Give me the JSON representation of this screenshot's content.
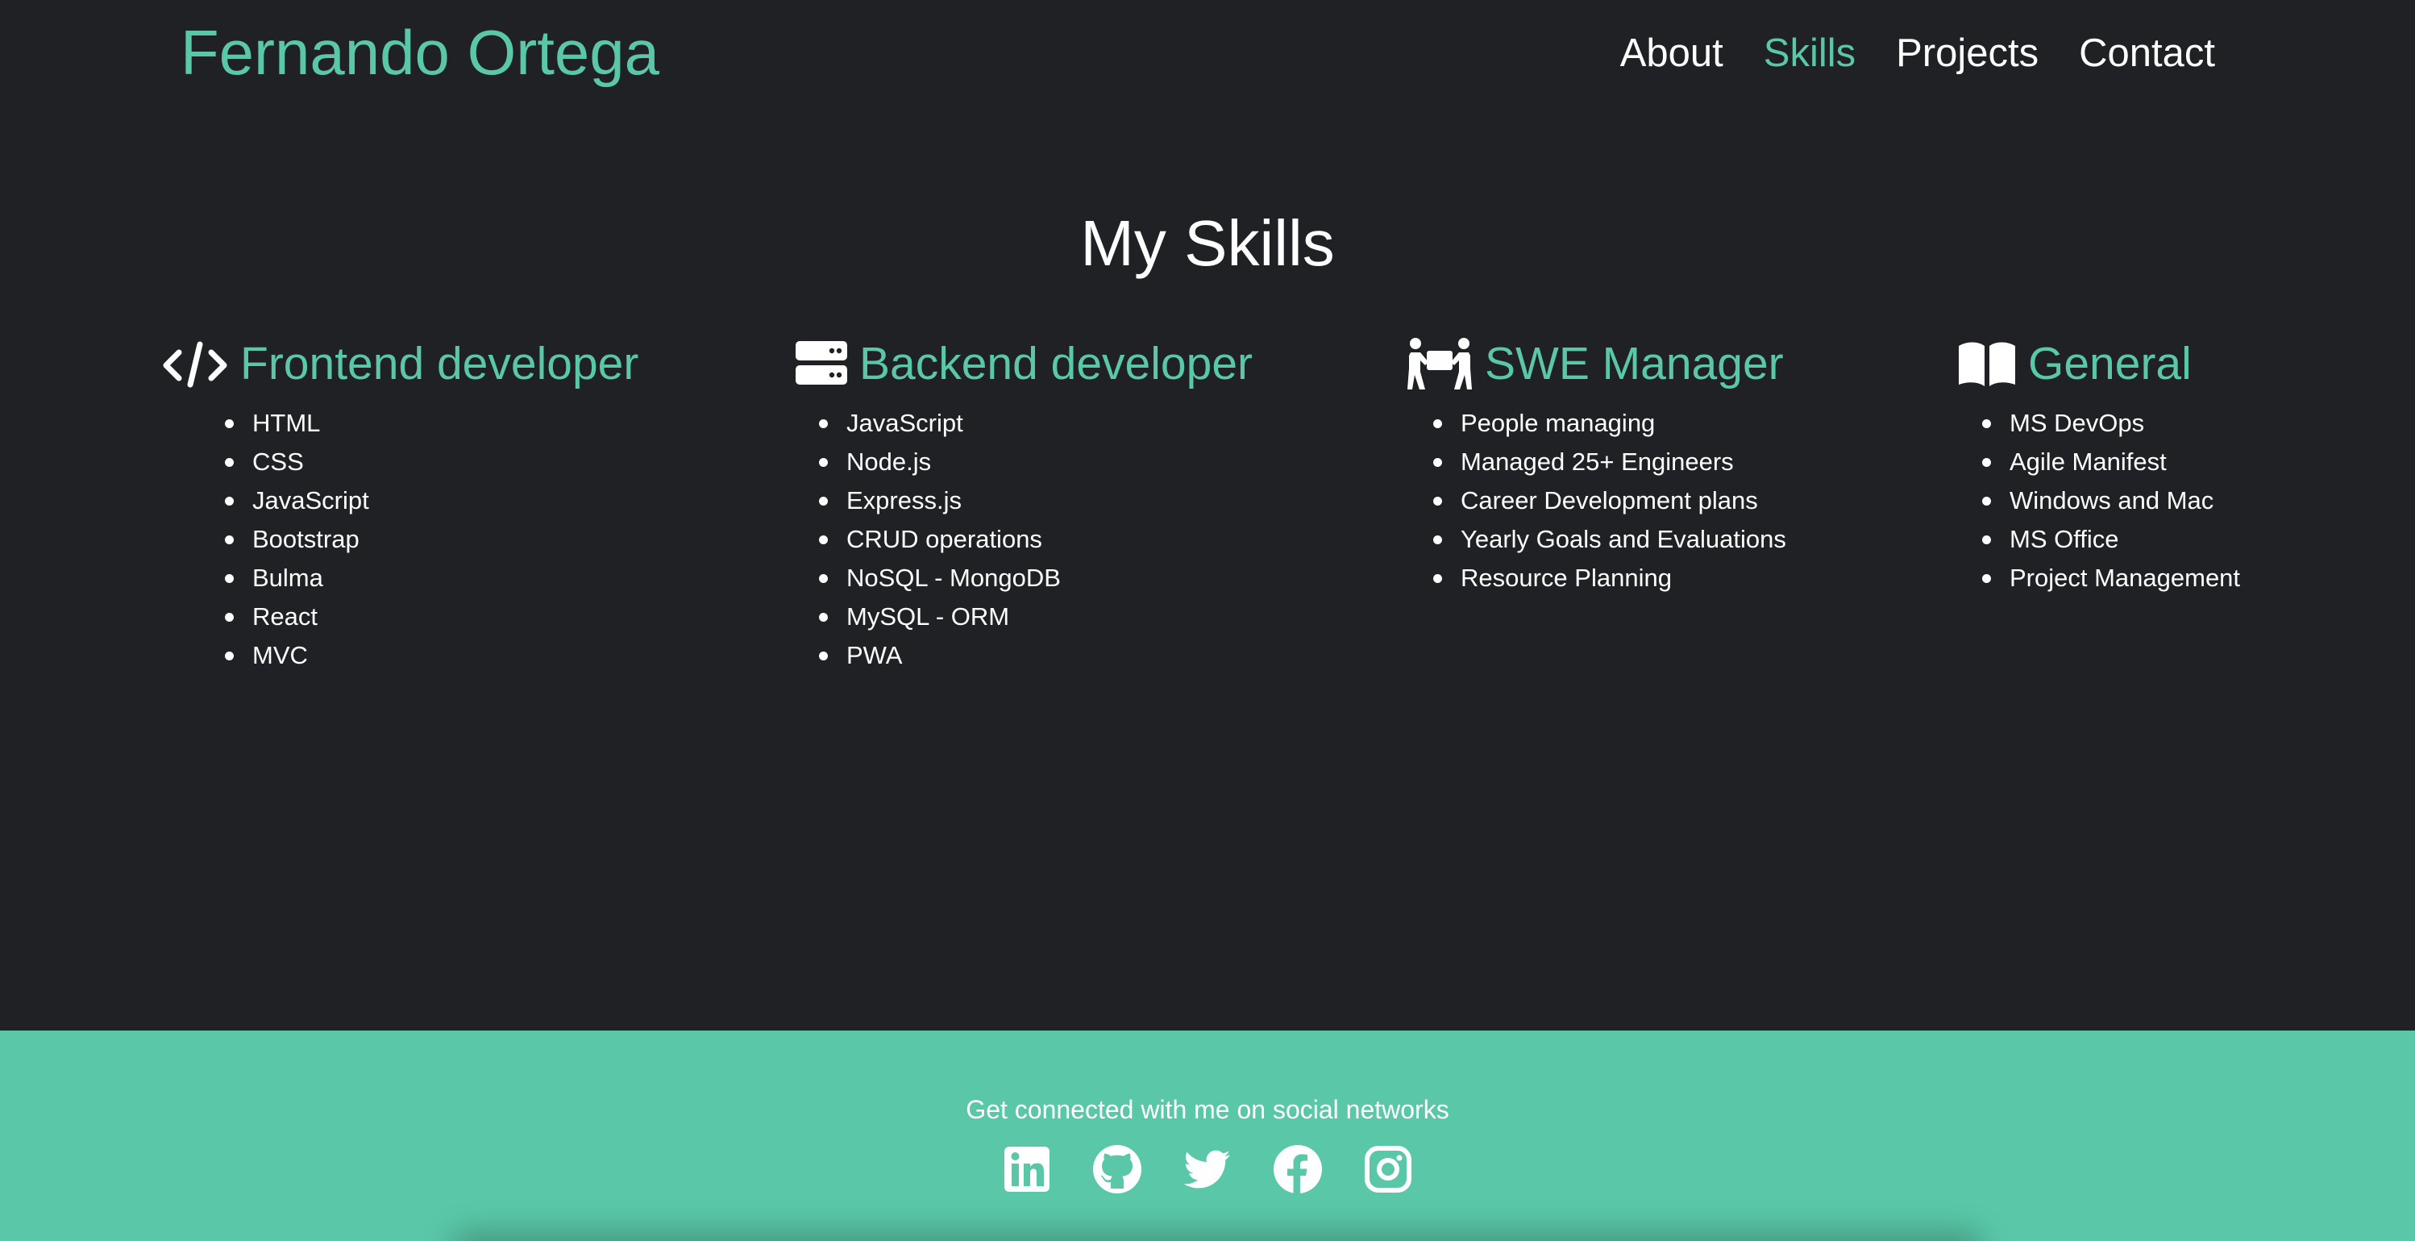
{
  "header": {
    "brand": "Fernando Ortega",
    "nav": [
      {
        "label": "About",
        "active": false
      },
      {
        "label": "Skills",
        "active": true
      },
      {
        "label": "Projects",
        "active": false
      },
      {
        "label": "Contact",
        "active": false
      }
    ]
  },
  "main": {
    "title": "My Skills",
    "columns": [
      {
        "icon": "code-icon",
        "heading": "Frontend developer",
        "items": [
          "HTML",
          "CSS",
          "JavaScript",
          "Bootstrap",
          "Bulma",
          "React",
          "MVC"
        ]
      },
      {
        "icon": "server-icon",
        "heading": "Backend developer",
        "items": [
          "JavaScript",
          "Node.js",
          "Express.js",
          "CRUD operations",
          "NoSQL - MongoDB",
          "MySQL - ORM",
          "PWA"
        ]
      },
      {
        "icon": "people-carry-icon",
        "heading": "SWE Manager",
        "items": [
          "People managing",
          "Managed 25+ Engineers",
          "Career Development plans",
          "Yearly Goals and Evaluations",
          "Resource Planning"
        ]
      },
      {
        "icon": "book-open-icon",
        "heading": "General",
        "items": [
          "MS DevOps",
          "Agile Manifest",
          "Windows and Mac",
          "MS Office",
          "Project Management"
        ]
      }
    ]
  },
  "footer": {
    "text": "Get connected with me on social networks",
    "social": [
      "linkedin-icon",
      "github-icon",
      "twitter-icon",
      "facebook-icon",
      "instagram-icon"
    ]
  },
  "colors": {
    "background": "#202125",
    "accent": "#5ac8a8",
    "text": "#ffffff"
  }
}
